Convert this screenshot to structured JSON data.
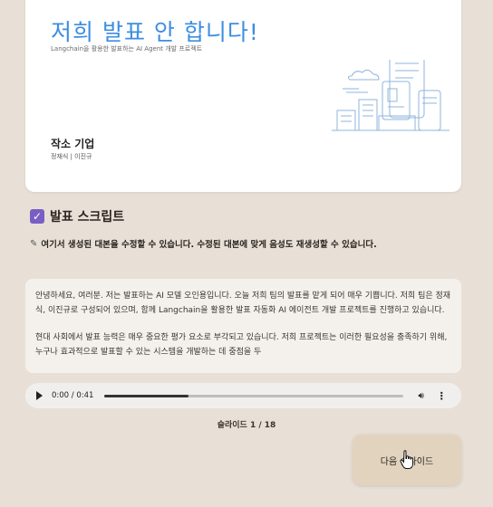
{
  "slide": {
    "title": "저희 발표 안 합니다!",
    "subtitle": "Langchain을 활용한 발표하는 AI Agent 개발 프로젝트",
    "company": "작소 기업",
    "members": "정재식 | 이진규",
    "illustration_icon": "city-buildings-illustration"
  },
  "script": {
    "checkbox_icon": "checkbox-checked-icon",
    "title": "발표 스크립트",
    "hint_icon": "pencil-icon",
    "hint": "여기서 생성된 대본을 수정할 수 있습니다. 수정된 대본에 맞게 음성도 재생성할 수 있습니다.",
    "paragraph1": "안녕하세요, 여러분. 저는 발표하는 AI 모델 오인용입니다. 오늘 저희 팀의 발표를 맡게 되어 매우 기쁩니다. 저희 팀은 정재식, 이진규로 구성되어 있으며, 함께 Langchain을 활용한 발표 자동화 AI 에이전트 개발 프로젝트를 진행하고 있습니다.",
    "paragraph2": "현대 사회에서 발표 능력은 매우 중요한 평가 요소로 부각되고 있습니다. 저희 프로젝트는 이러한 필요성을 충족하기 위해, 누구나 효과적으로 발표할 수 있는 시스템을 개발하는 데 중점을 두"
  },
  "audio": {
    "time": "0:00 / 0:41",
    "played_fraction": 0.0,
    "buffered_fraction": 0.28,
    "play_icon": "play-icon",
    "volume_icon": "volume-icon",
    "more_icon": "more-vertical-icon"
  },
  "navigation": {
    "counter_label": "슬라이드",
    "counter_value": "1 / 18",
    "next_label": "다음 슬라이드"
  },
  "colors": {
    "background": "#e8e0d6",
    "title_blue": "#3d8ee0",
    "checkbox_purple": "#7b5ec4",
    "next_button": "#e2d3bf"
  }
}
